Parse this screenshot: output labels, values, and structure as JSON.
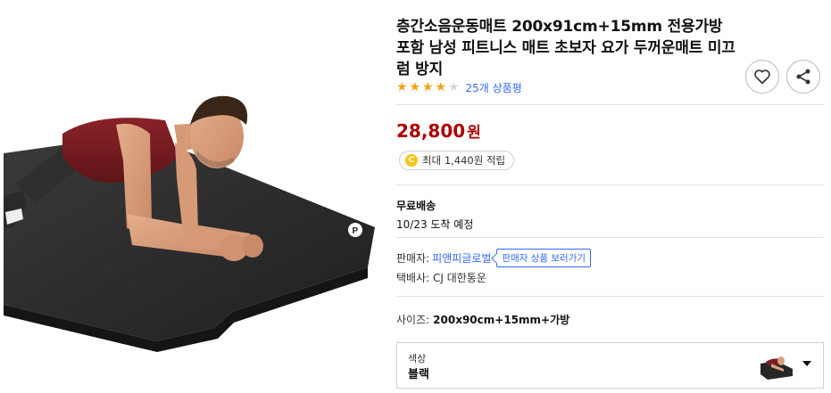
{
  "product": {
    "title": "층간소음운동매트 200x91cm+15mm 전용가방 포함 남성 피트니스 매트 초보자 요가 두꺼운매트 미끄럼 방지",
    "rating": 4,
    "rating_max": 5,
    "review_count_label": "25개 상품평"
  },
  "price": {
    "amount": "28,800",
    "unit": "원"
  },
  "reward": {
    "coin_symbol": "C",
    "label": "최대 1,440원 적립"
  },
  "shipping": {
    "title": "무료배송",
    "arrival": "10/23 도착 예정"
  },
  "seller": {
    "label": "판매자:",
    "name": "피앤피글로벌",
    "view_button": "판매자 상품 보러가기",
    "courier": "택배사: CJ 대한통운"
  },
  "options": {
    "size_label": "사이즈:",
    "size_value": "200x90cm+15mm+가방",
    "color_label": "색상",
    "color_value": "블랙"
  },
  "image": {
    "mat_brand_mark": "P"
  },
  "colors": {
    "price": "#ae0000",
    "link": "#346aff",
    "star": "#f4a216",
    "star_empty": "#d6d6d6",
    "mat": "#2b2b2b",
    "shirt": "#7a1c22"
  },
  "icons": [
    "heart-icon",
    "share-icon",
    "star-icon",
    "coin-icon",
    "chevron-down-icon"
  ]
}
